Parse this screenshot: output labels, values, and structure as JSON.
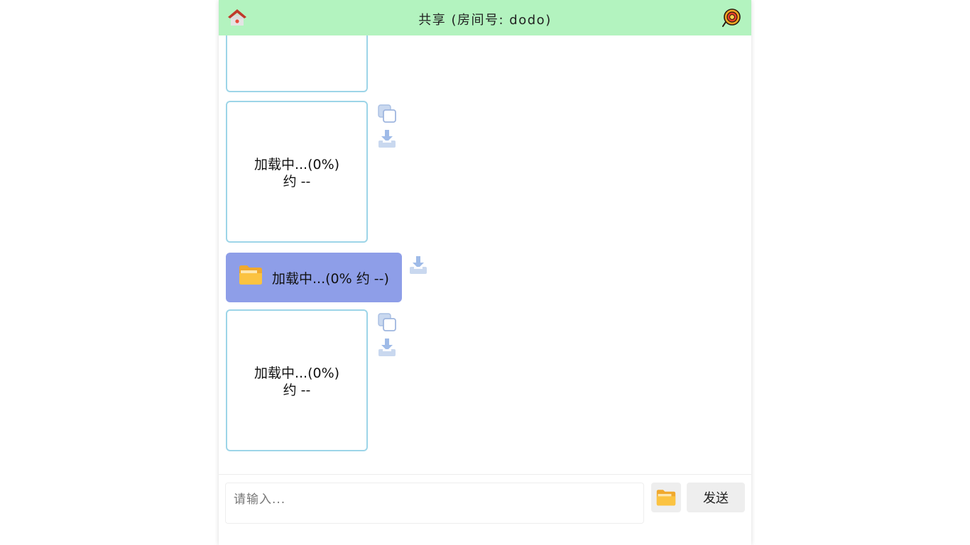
{
  "header": {
    "title": "共享 (房间号: dodo)",
    "background": "#b3f3bf",
    "left_icon": "home-icon",
    "right_icon": "brand-logo-icon"
  },
  "messages": [
    {
      "type": "image",
      "loading_line1": "",
      "loading_line2": "",
      "actions": []
    },
    {
      "type": "image",
      "loading_line1": "加载中...(0%)",
      "loading_line2": "约 --",
      "actions": [
        "copy-icon",
        "download-icon"
      ]
    },
    {
      "type": "file",
      "icon": "folder-icon",
      "text": "加载中...(0% 约 --)",
      "background": "#8e9ee8",
      "actions": [
        "download-icon"
      ]
    },
    {
      "type": "image",
      "loading_line1": "加载中...(0%)",
      "loading_line2": "约 --",
      "actions": [
        "copy-icon",
        "download-icon"
      ]
    }
  ],
  "composer": {
    "placeholder": "请输入...",
    "value": "",
    "file_button_icon": "folder-icon",
    "send_label": "发送"
  }
}
